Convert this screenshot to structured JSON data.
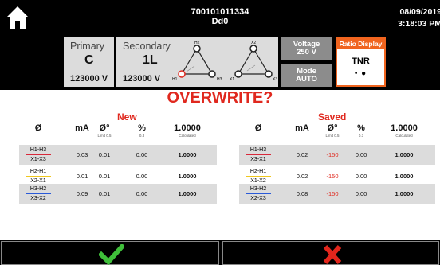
{
  "header": {
    "serial": "700101011334",
    "sub": "Dd0",
    "date": "08/09/2019",
    "time": "3:18:03 PM"
  },
  "primary": {
    "label": "Primary",
    "connection": "C",
    "voltage": "123000 V"
  },
  "secondary": {
    "label": "Secondary",
    "connection": "1L",
    "voltage": "123000 V"
  },
  "diagram": {
    "primary_terminals": [
      "H2",
      "H1",
      "H3"
    ],
    "secondary_terminals": [
      "X2",
      "X1",
      "X3"
    ]
  },
  "voltage_btn": {
    "label": "Voltage",
    "value": "250 V"
  },
  "mode_btn": {
    "label": "Mode",
    "value": "AUTO"
  },
  "ratio_display": {
    "label": "Ratio Display",
    "value": "TNR",
    "dots": "• ●"
  },
  "title": "OVERWRITE?",
  "columns": {
    "phase": "Ø",
    "ma": "mA",
    "deg": "Ø°",
    "deg_limit": "Limit 0.5",
    "pct": "%",
    "pct_sub": "0.3",
    "ratio": "1.0000",
    "ratio_sub": "Calculated"
  },
  "new": {
    "label": "New",
    "rows": [
      {
        "top": "H1-H3",
        "bottom": "X1-X3",
        "line_color": "#d8283a",
        "ma": "0.03",
        "deg": "0.01",
        "pct": "0.00",
        "ratio": "1.0000"
      },
      {
        "top": "H2-H1",
        "bottom": "X2-X1",
        "line_color": "#f0c81e",
        "ma": "0.01",
        "deg": "0.01",
        "pct": "0.00",
        "ratio": "1.0000"
      },
      {
        "top": "H3-H2",
        "bottom": "X3-X2",
        "line_color": "#2a5ad8",
        "ma": "0.09",
        "deg": "0.01",
        "pct": "0.00",
        "ratio": "1.0000"
      }
    ]
  },
  "saved": {
    "label": "Saved",
    "rows": [
      {
        "top": "H1-H3",
        "bottom": "X3-X1",
        "line_color": "#d8283a",
        "ma": "0.02",
        "deg": "-150",
        "pct": "0.00",
        "ratio": "1.0000"
      },
      {
        "top": "H2-H1",
        "bottom": "X1-X2",
        "line_color": "#f0c81e",
        "ma": "0.02",
        "deg": "-150",
        "pct": "0.00",
        "ratio": "1.0000"
      },
      {
        "top": "H3-H2",
        "bottom": "X2-X3",
        "line_color": "#2a5ad8",
        "ma": "0.08",
        "deg": "-150",
        "pct": "0.00",
        "ratio": "1.0000"
      }
    ]
  },
  "colors": {
    "accent": "#f0641e",
    "alert": "#e0281e",
    "confirm": "#3fbf3a",
    "cancel": "#e3261c"
  }
}
